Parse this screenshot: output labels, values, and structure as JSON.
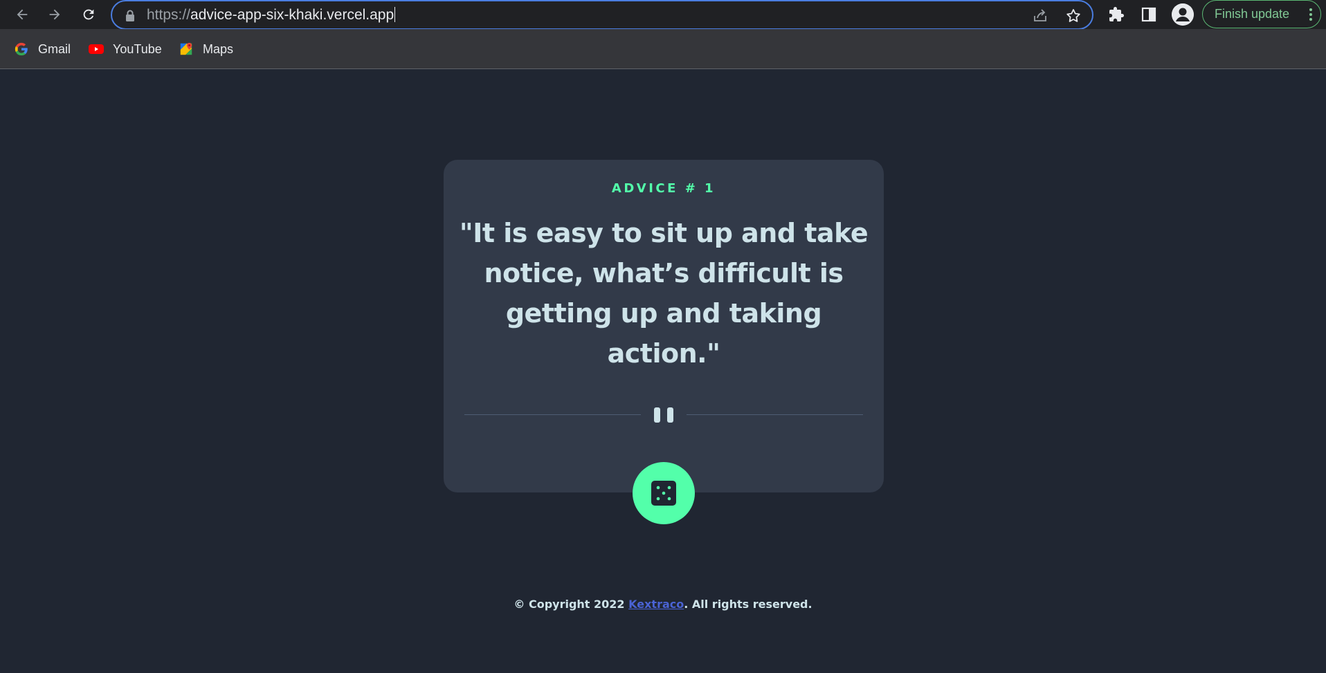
{
  "browser": {
    "url_scheme": "https://",
    "url_host": "advice-app-six-khaki.vercel.app",
    "finish_update_label": "Finish update",
    "bookmarks": [
      {
        "label": "Gmail",
        "icon": "google-icon"
      },
      {
        "label": "YouTube",
        "icon": "youtube-icon"
      },
      {
        "label": "Maps",
        "icon": "maps-icon"
      }
    ]
  },
  "card": {
    "advice_label": "ADVICE # 1",
    "quote": "\"It is easy to sit up and take notice, what’s difficult is getting up and taking action.\"",
    "divider_icon": "pause-icon",
    "generate_icon": "dice-icon"
  },
  "footer": {
    "prefix": "© Copyright 2022 ",
    "link_text": "Kextraco",
    "suffix": ". All rights reserved."
  },
  "colors": {
    "background": "#202632",
    "card": "#323a49",
    "accent": "#53ffaa",
    "text": "#cee3e9",
    "link": "#4a63d4"
  }
}
